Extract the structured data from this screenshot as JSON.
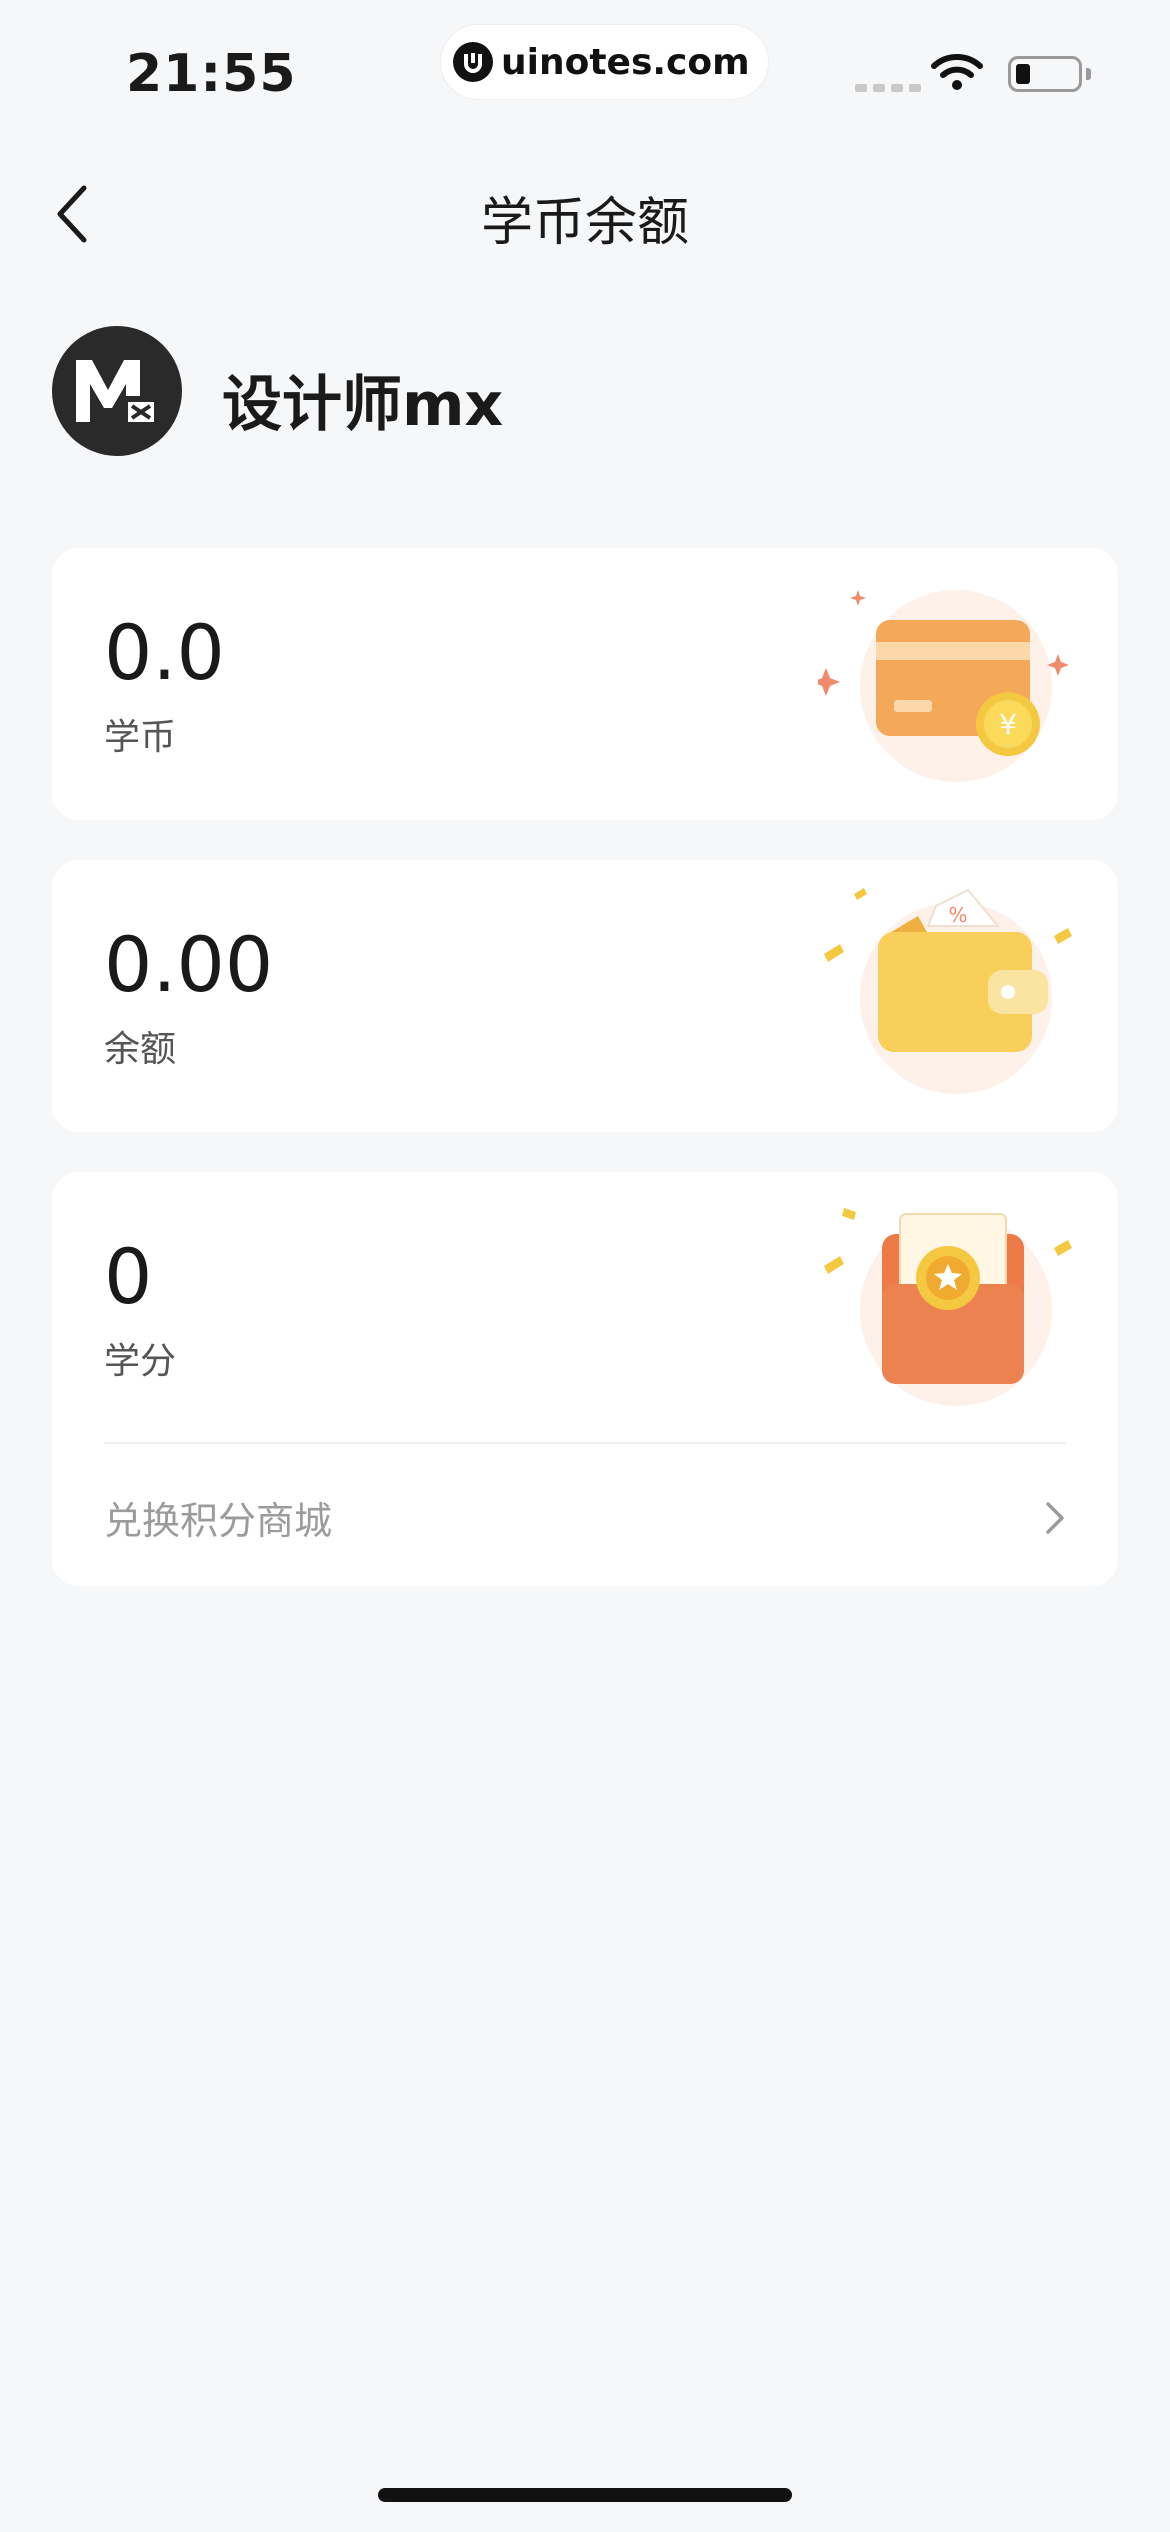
{
  "status_bar": {
    "time": "21:55",
    "watermark": "uinotes.com",
    "icons": [
      "signal-icon",
      "wifi-icon",
      "battery-icon"
    ]
  },
  "nav": {
    "title": "学币余额",
    "back_icon": "chevron-left-icon"
  },
  "user": {
    "name": "设计师mx",
    "avatar_icon": "mx-logo-avatar"
  },
  "cards": [
    {
      "value": "0.0",
      "label": "学币",
      "illustration": "card-coin-illustration"
    },
    {
      "value": "0.00",
      "label": "余额",
      "illustration": "wallet-illustration"
    },
    {
      "value": "0",
      "label": "学分",
      "illustration": "red-envelope-illustration",
      "link": {
        "label": "兑换积分商城",
        "icon": "chevron-right-icon"
      }
    }
  ],
  "colors": {
    "background": "#f6f7f9",
    "card": "#ffffff",
    "accent_orange": "#f0a050",
    "accent_gold": "#f5c842",
    "accent_red": "#e86a3a"
  }
}
